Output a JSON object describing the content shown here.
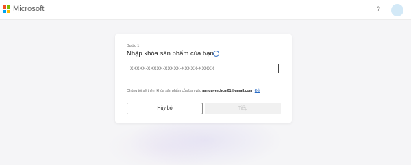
{
  "header": {
    "brand": "Microsoft",
    "help_label": "?",
    "logo_colors": [
      "#f25022",
      "#7fba00",
      "#00a4ef",
      "#ffb900"
    ]
  },
  "dialog": {
    "step_label": "Bước 1",
    "title": "Nhập khóa sản phẩm của bạn",
    "info_icon": "i",
    "key_input": {
      "placeholder": "XXXXX-XXXXX-XXXXX-XXXXX-XXXXX",
      "value": ""
    },
    "note_prefix": "Chúng tôi sẽ thêm khóa sản phẩm của bạn vào",
    "email": "annguyen.hcm01@gmail.com",
    "change_link": "Đổi",
    "cancel_label": "Hủy bỏ",
    "next_label": "Tiếp"
  }
}
